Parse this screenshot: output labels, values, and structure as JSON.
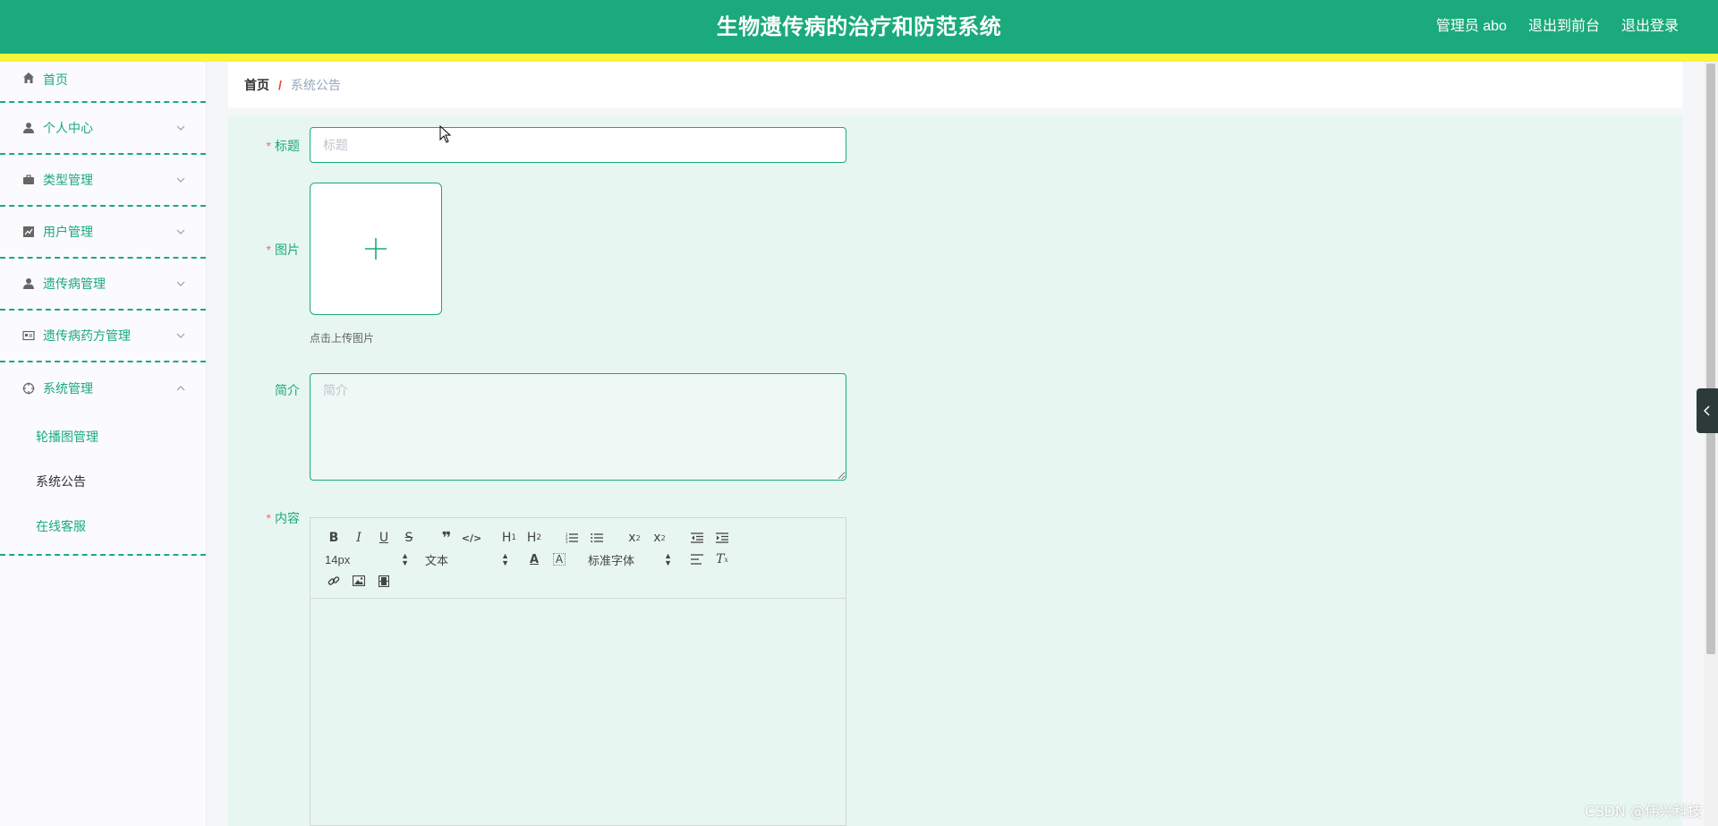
{
  "header": {
    "title": "生物遗传病的治疗和防范系统",
    "user_label": "管理员 abo",
    "to_front_label": "退出到前台",
    "logout_label": "退出登录"
  },
  "sidebar": {
    "items": [
      {
        "label": "首页",
        "icon": "home-icon"
      },
      {
        "label": "个人中心",
        "icon": "user-icon"
      },
      {
        "label": "类型管理",
        "icon": "briefcase-icon"
      },
      {
        "label": "用户管理",
        "icon": "chart-icon"
      },
      {
        "label": "遗传病管理",
        "icon": "user-icon"
      },
      {
        "label": "遗传病药方管理",
        "icon": "card-icon"
      },
      {
        "label": "系统管理",
        "icon": "target-icon"
      }
    ],
    "sub_items": [
      {
        "label": "轮播图管理"
      },
      {
        "label": "系统公告"
      },
      {
        "label": "在线客服"
      }
    ]
  },
  "breadcrumb": {
    "home": "首页",
    "separator": "/",
    "current": "系统公告"
  },
  "form": {
    "required_mark": "*",
    "title_label": "标题",
    "title_placeholder": "标题",
    "title_value": "",
    "image_label": "图片",
    "upload_hint": "点击上传图片",
    "intro_label": "简介",
    "intro_placeholder": "简介",
    "content_label": "内容"
  },
  "editor": {
    "toolbar_row1": [
      "B",
      "I",
      "U",
      "S",
      "quote",
      "code",
      "H1",
      "H2",
      "ol",
      "ul",
      "sub",
      "sup",
      "outdent",
      "indent"
    ],
    "font_size": "14px",
    "header_select": "文本",
    "font_family": "标准字体"
  },
  "watermark": "CSDN @伟兴科技",
  "colors": {
    "brand": "#1aaa7b",
    "header_strip": "#f5f53a",
    "panel_bg": "#e8f6f1",
    "required": "#f56c6c"
  }
}
